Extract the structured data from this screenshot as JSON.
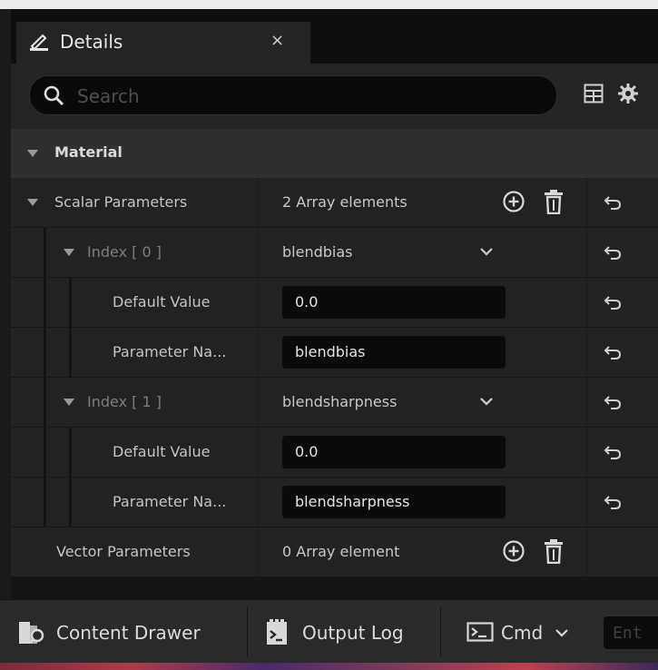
{
  "tab": {
    "title": "Details",
    "close": "×",
    "icon": "pencil-note-icon"
  },
  "search": {
    "placeholder": "Search",
    "value": ""
  },
  "toolbar": {
    "table_view_icon": "table-icon",
    "settings_icon": "gear-icon"
  },
  "section": {
    "title": "Material"
  },
  "scalar": {
    "label": "Scalar Parameters",
    "count": "2 Array elements",
    "items": [
      {
        "index_label": "Index [ 0 ]",
        "name_value": "blendbias",
        "default_label": "Default Value",
        "default_value": "0.0",
        "param_label": "Parameter Na...",
        "param_value": "blendbias"
      },
      {
        "index_label": "Index [ 1 ]",
        "name_value": "blendsharpness",
        "default_label": "Default Value",
        "default_value": "0.0",
        "param_label": "Parameter Na...",
        "param_value": "blendsharpness"
      }
    ]
  },
  "vector": {
    "label": "Vector Parameters",
    "count": "0 Array element"
  },
  "bottom": {
    "content_drawer": "Content Drawer",
    "output_log": "Output Log",
    "cmd": "Cmd",
    "cmd_placeholder": "Ent"
  },
  "colors": {
    "panel": "#151515",
    "row": "#222222",
    "section": "#2f2f2f",
    "field": "#0b0b0b"
  }
}
